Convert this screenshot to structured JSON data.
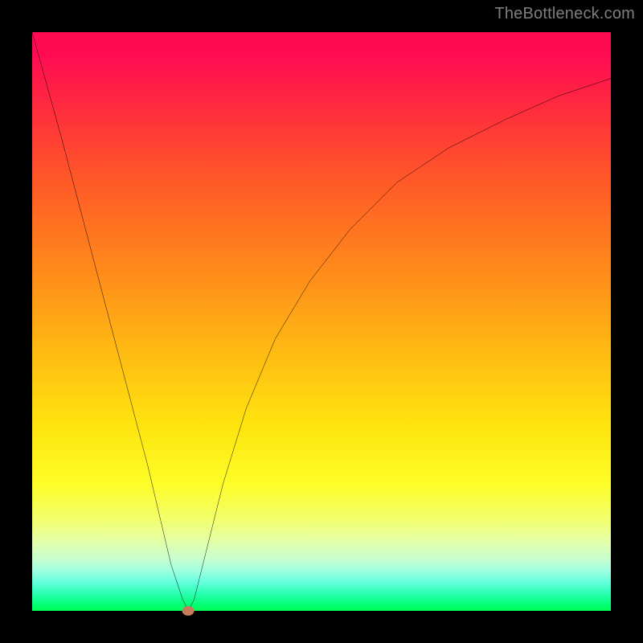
{
  "attribution": "TheBottleneck.com",
  "chart_data": {
    "type": "line",
    "title": "",
    "xlabel": "",
    "ylabel": "",
    "xlim": [
      0,
      100
    ],
    "ylim": [
      0,
      100
    ],
    "grid": false,
    "legend": false,
    "series": [
      {
        "name": "bottleneck-curve",
        "x": [
          0,
          5,
          10,
          15,
          20,
          24,
          26,
          27,
          28,
          30,
          33,
          37,
          42,
          48,
          55,
          63,
          72,
          82,
          91,
          100
        ],
        "values": [
          100,
          82,
          63,
          44,
          25,
          8,
          2,
          0,
          2,
          10,
          22,
          35,
          47,
          57,
          66,
          74,
          80,
          85,
          89,
          92
        ]
      }
    ],
    "marker": {
      "x": 27,
      "y": 0,
      "color": "#c77b5d"
    },
    "background_gradient": {
      "orientation": "vertical",
      "stops": [
        {
          "pos": 0,
          "color": "#ff0b52"
        },
        {
          "pos": 50,
          "color": "#ff9a17"
        },
        {
          "pos": 78,
          "color": "#fdfd27"
        },
        {
          "pos": 100,
          "color": "#00ff55"
        }
      ]
    },
    "frame_color": "#000000",
    "curve_color": "#000000"
  }
}
